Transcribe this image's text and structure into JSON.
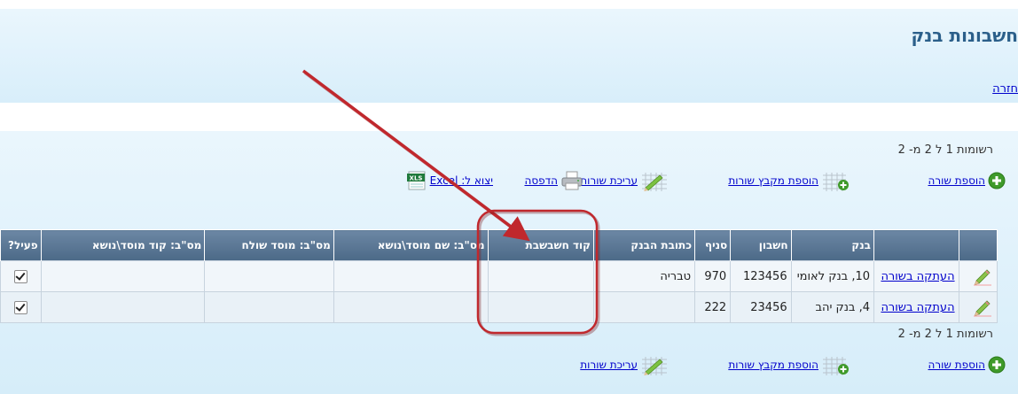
{
  "page": {
    "title": "חשבונות בנק",
    "back_link": "חזרה"
  },
  "records_top": "רשומות 1 ל 2 מ- 2",
  "records_bottom": "רשומות 1 ל 2 מ- 2",
  "toolbar": {
    "add_row": "הוספת שורה",
    "add_rows_file": "הוספת מקבץ שורות",
    "edit_rows": "עריכת שורות",
    "print": "הדפסה",
    "export_excel": "יצוא ל: Excel",
    "xls_badge": "XLS"
  },
  "table": {
    "headers": [
      "בנק",
      "חשבון",
      "סניף",
      "כתובת הבנק",
      "קוד חשבשבת",
      "מס\"ב: שם מוסד\\נושא",
      "מס\"ב: מוסד שולח",
      "מס\"ב: קוד מוסד\\נושא",
      "פעיל?"
    ],
    "copy_label": "העתקה בשורה",
    "rows": [
      {
        "bank": "10, בנק לאומי",
        "account": "123456",
        "branch": "970",
        "address": "טבריה",
        "hashavshevet": "",
        "masav_name": "",
        "masav_sender": "",
        "masav_code": "",
        "active": true
      },
      {
        "bank": "4, בנק יהב",
        "account": "23456",
        "branch": "222",
        "address": "",
        "hashavshevet": "",
        "masav_name": "",
        "masav_sender": "",
        "masav_code": "",
        "active": true
      }
    ]
  },
  "colors": {
    "header_bg": "#5b7895",
    "panel_bg": "#dff1fb",
    "link": "#0000cc",
    "annotation": "#c0282d"
  }
}
